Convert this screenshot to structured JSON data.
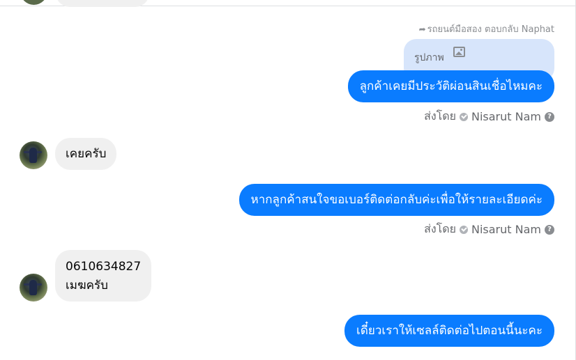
{
  "reply_context": {
    "label": "รถยนต์มือสอง ตอบกลับ Naphat",
    "quoted_label": "รูปภาพ",
    "quoted_icon": "image-icon"
  },
  "messages": [
    {
      "direction": "out",
      "text": "ลูกค้าเคยมีประวัติผ่อนสินเชื่อไหมคะ"
    },
    {
      "direction": "in",
      "text": "เคยครับ"
    },
    {
      "direction": "out",
      "text": "หากลูกค้าสนใจขอเบอร์ติดต่อกลับค่ะเพื่อให้รายละเอียดค่ะ"
    },
    {
      "direction": "in",
      "text_line1": "0610634827",
      "text_line2": "เมฆครับ"
    },
    {
      "direction": "out",
      "text": "เดี๋ยวเราให้เซลล์ติดต่อไปตอนนี้นะคะ"
    }
  ],
  "sent_by": {
    "prefix": "ส่งโดย",
    "name": "Nisarut Nam",
    "info": "?"
  },
  "colors": {
    "outgoing_bubble": "#0a7cff",
    "incoming_bubble": "#f0f0f0",
    "quoted_bubble": "#d7e5fb",
    "meta_text": "#65676b"
  }
}
